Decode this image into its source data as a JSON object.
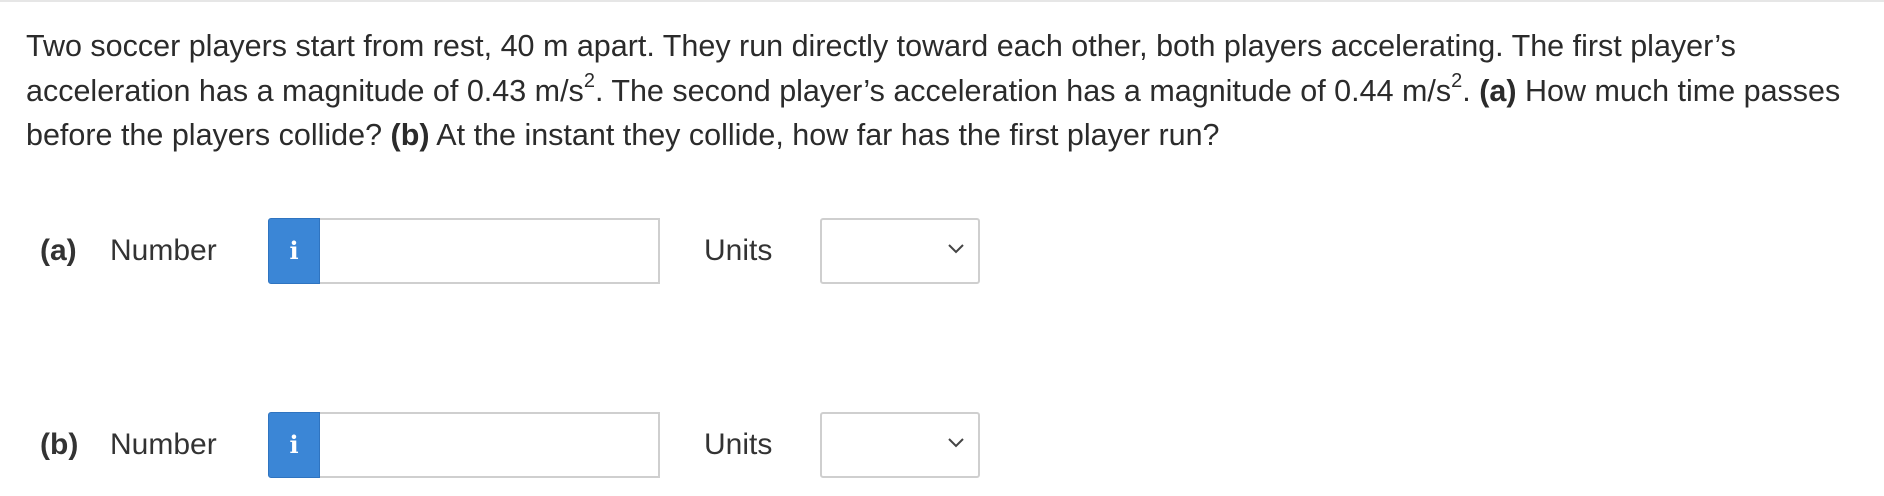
{
  "question": {
    "intro": "Two soccer players start from rest, 40 m apart. They run directly toward each other, both players accelerating. The first player’s acceleration has a magnitude of 0.43 m/s",
    "exp1": "2",
    "mid": ". The second player’s acceleration has a magnitude of 0.44 m/s",
    "exp2": "2",
    "mid2": ". ",
    "part_a_tag": "(a)",
    "part_a_text": " How much time passes before the players collide? ",
    "part_b_tag": "(b)",
    "part_b_text": " At the instant they collide, how far has the first player run?"
  },
  "answers": [
    {
      "part": "(a)",
      "number_label": "Number",
      "info_icon": "i",
      "number_value": "",
      "units_label": "Units",
      "units_value": ""
    },
    {
      "part": "(b)",
      "number_label": "Number",
      "info_icon": "i",
      "number_value": "",
      "units_label": "Units",
      "units_value": ""
    }
  ],
  "colors": {
    "info_button": "#3b86d6",
    "text": "#2b2b2b",
    "border": "#cfcfcf"
  },
  "icons": {
    "info": "info-icon",
    "dropdown": "chevron-down-icon"
  }
}
